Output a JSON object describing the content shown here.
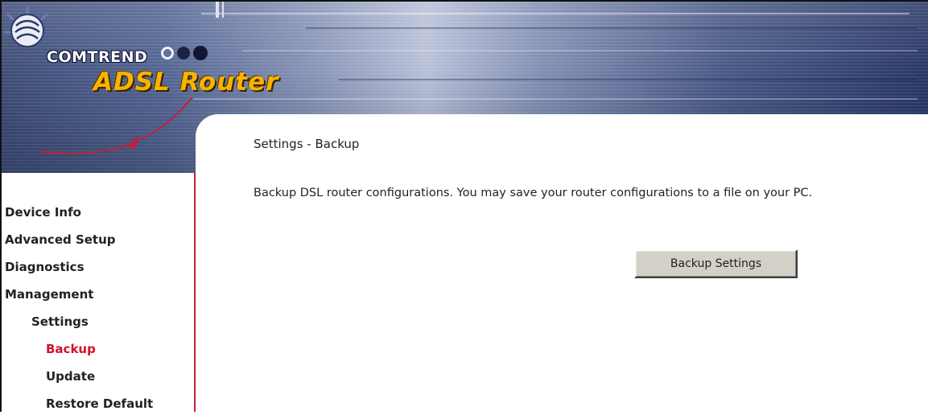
{
  "header": {
    "brand": "COMTREND",
    "product": "ADSL Router"
  },
  "colors": {
    "accent_red": "#d0102c",
    "banner_blue": "#3f4d78",
    "logo_gold": "#f6b400",
    "button_face": "#d4d0c8"
  },
  "sidebar": {
    "items": [
      {
        "label": "Device Info"
      },
      {
        "label": "Advanced Setup"
      },
      {
        "label": "Diagnostics"
      },
      {
        "label": "Management"
      },
      {
        "label": "Settings"
      },
      {
        "label": "Backup"
      },
      {
        "label": "Update"
      },
      {
        "label": "Restore Default"
      }
    ]
  },
  "main": {
    "title": "Settings - Backup",
    "description": "Backup DSL router configurations. You may save your router configurations to a file on your PC.",
    "backup_button": "Backup Settings"
  },
  "icons": [
    "comtrend-logo-icon",
    "swoosh-icon"
  ]
}
